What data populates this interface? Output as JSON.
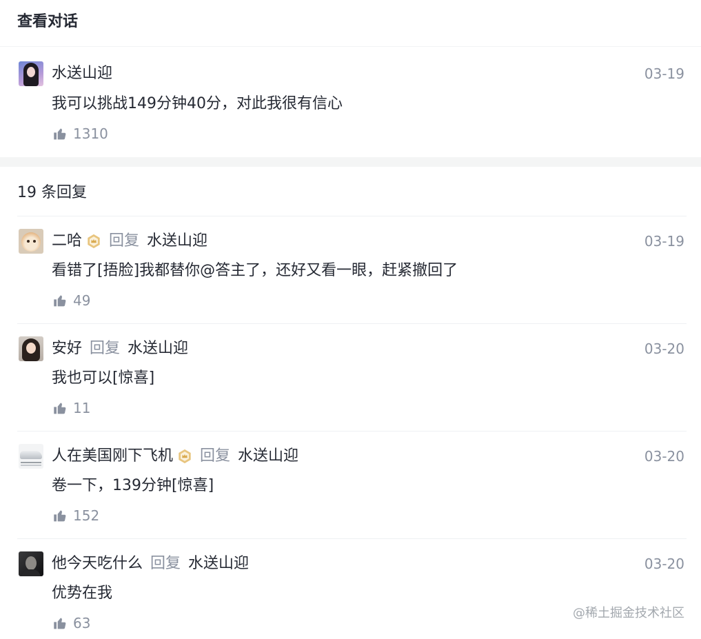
{
  "header": {
    "title": "查看对话"
  },
  "main_comment": {
    "author": "水送山迎",
    "date": "03-19",
    "content": "我可以挑战149分钟40分，对此我很有信心",
    "likes": 1310
  },
  "replies_section": {
    "count_label": "19 条回复"
  },
  "labels": {
    "reply": "回复"
  },
  "replies": [
    {
      "author": "二哈",
      "has_badge": true,
      "reply_to": "水送山迎",
      "date": "03-19",
      "content": "看错了[捂脸]我都替你@答主了，还好又看一眼，赶紧撤回了",
      "likes": 49
    },
    {
      "author": "安好",
      "has_badge": false,
      "reply_to": "水送山迎",
      "date": "03-20",
      "content": "我也可以[惊喜]",
      "likes": 11
    },
    {
      "author": "人在美国刚下飞机",
      "has_badge": true,
      "reply_to": "水送山迎",
      "date": "03-20",
      "content": "卷一下，139分钟[惊喜]",
      "likes": 152
    },
    {
      "author": "他今天吃什么",
      "has_badge": false,
      "reply_to": "水送山迎",
      "date": "03-20",
      "content": "优势在我",
      "likes": 63
    }
  ],
  "watermark": "@稀土掘金技术社区",
  "icons": {
    "like": "thumbs-up-icon",
    "badge": "level-badge-icon"
  },
  "colors": {
    "text": "#252933",
    "muted": "#8a919f",
    "divider": "#eef0f3",
    "band": "#f4f5f5",
    "badge_gold": "#e8c57f"
  }
}
